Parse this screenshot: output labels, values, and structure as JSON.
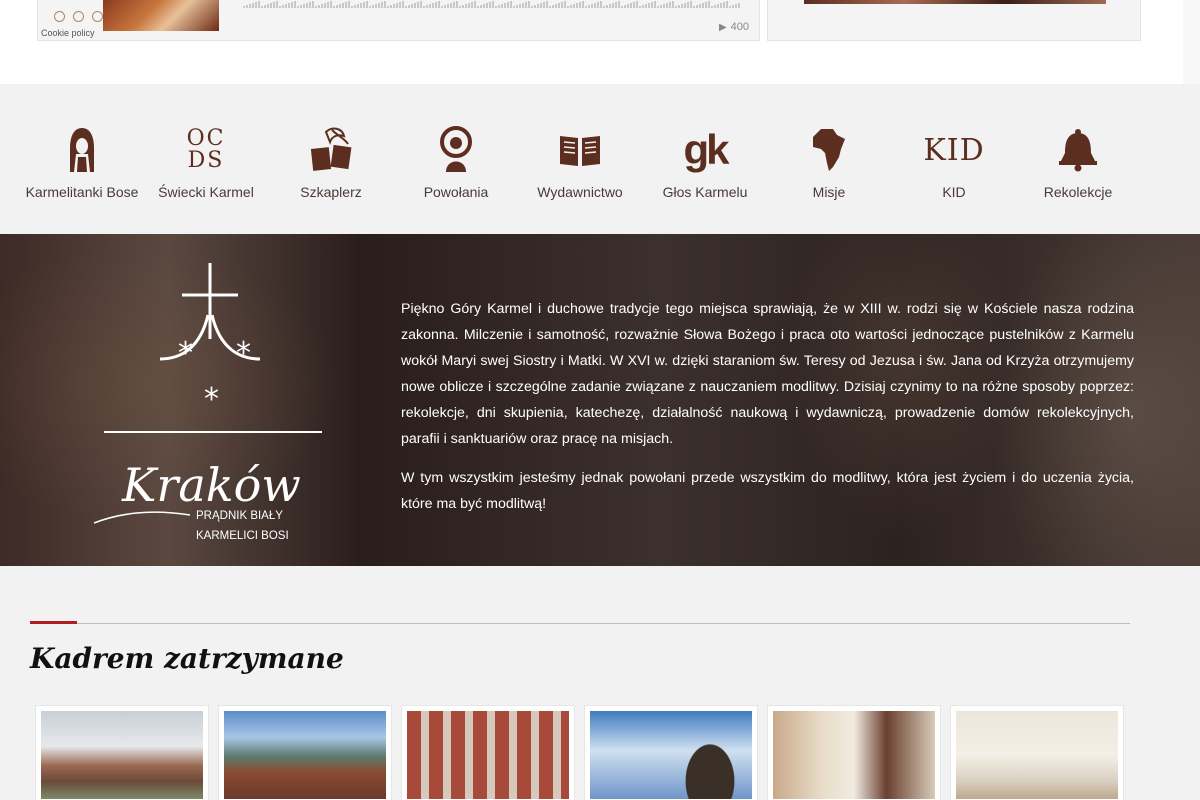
{
  "top": {
    "cookie_policy": "Cookie policy",
    "play_count": "400",
    "play_icon": "play-icon"
  },
  "nav": {
    "items": [
      {
        "label": "Karmelitanki Bose",
        "icon": "nun-icon"
      },
      {
        "label": "Świecki Karmel",
        "icon": "ocds-icon",
        "icon_text": [
          "OC",
          "DS"
        ]
      },
      {
        "label": "Szkaplerz",
        "icon": "scapular-icon"
      },
      {
        "label": "Powołania",
        "icon": "vocation-icon"
      },
      {
        "label": "Wydawnictwo",
        "icon": "book-icon"
      },
      {
        "label": "Głos Karmelu",
        "icon": "gk-icon",
        "icon_text": "gk"
      },
      {
        "label": "Misje",
        "icon": "africa-icon"
      },
      {
        "label": "KID",
        "icon": "kid-icon",
        "icon_text": "KID"
      },
      {
        "label": "Rekolekcje",
        "icon": "bell-icon"
      }
    ],
    "icon_color": "#5c2e1f"
  },
  "hero": {
    "logo": {
      "city": "Kraków",
      "line1": "PRĄDNIK BIAŁY",
      "line2": "KARMELICI BOSI"
    },
    "paragraph1": "Piękno Góry Karmel i duchowe tradycje tego miejsca sprawiają, że w XIII w. rodzi się w Kościele nasza rodzina zakonna. Milczenie i samotność, rozważnie Słowa Bożego i praca oto wartości jednoczące pustelników z Karmelu wokół Maryi swej Siostry i Matki. W XVI w. dzięki staraniom św. Teresy od Jezusa i św. Jana od Krzyża otrzymujemy nowe oblicze i szczególne zadanie związane z nauczaniem modlitwy. Dzisiaj czynimy to na różne sposoby poprzez: rekolekcje, dni skupienia, katechezę, działalność naukową i wydawniczą, prowadzenie domów rekolekcyjnych, parafii i sanktuariów oraz pracę na misjach.",
    "paragraph2": "W tym wszystkim jesteśmy jednak powołani przede wszystkim do modlitwy, która jest życiem i do uczenia życia, które ma być modlitwą!"
  },
  "section": {
    "title": "Kadrem zatrzymane",
    "accent_color": "#b11d22"
  }
}
